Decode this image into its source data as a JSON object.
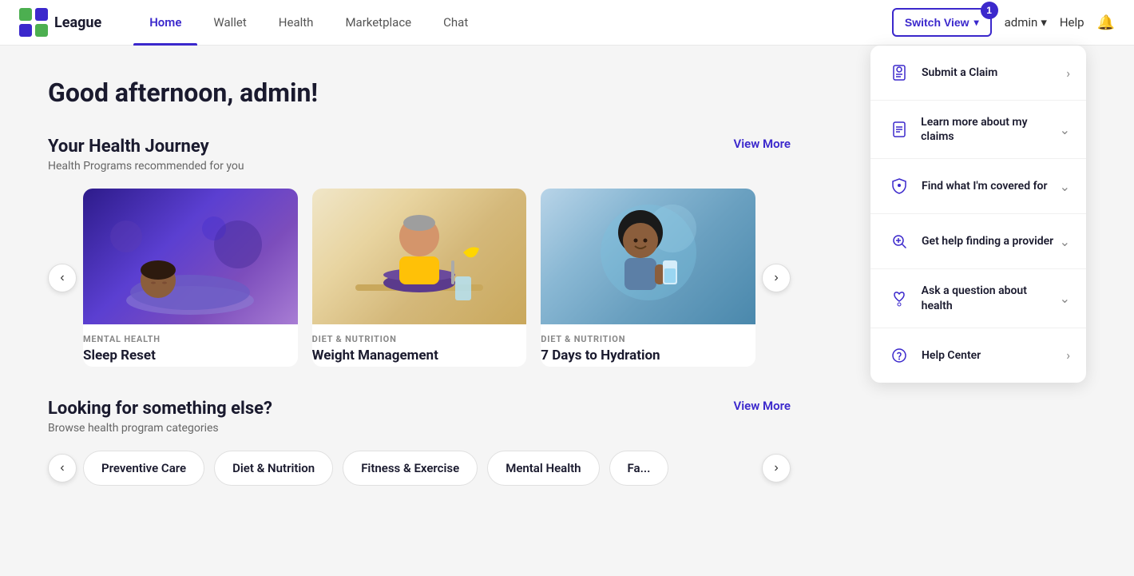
{
  "logo": {
    "text": "League",
    "alt": "League logo"
  },
  "nav": {
    "links": [
      {
        "label": "Home",
        "active": true
      },
      {
        "label": "Wallet",
        "active": false
      },
      {
        "label": "Health",
        "active": false
      },
      {
        "label": "Marketplace",
        "active": false
      },
      {
        "label": "Chat",
        "active": false
      }
    ],
    "switch_view_label": "Switch View",
    "switch_view_badge": "1",
    "admin_label": "admin",
    "help_label": "Help"
  },
  "greeting": "Good afternoon, admin!",
  "health_journey": {
    "title": "Your Health Journey",
    "subtitle": "Health Programs recommended for you",
    "view_more": "View More",
    "cards": [
      {
        "category": "MENTAL HEALTH",
        "title": "Sleep Reset",
        "bg": "sleep"
      },
      {
        "category": "DIET & NUTRITION",
        "title": "Weight Management",
        "bg": "weight"
      },
      {
        "category": "DIET & NUTRITION",
        "title": "7 Days to Hydration",
        "bg": "hydration"
      }
    ]
  },
  "looking_for": {
    "title": "Looking for something else?",
    "subtitle": "Browse health program categories",
    "view_more": "View More",
    "categories": [
      {
        "label": "Preventive Care"
      },
      {
        "label": "Diet & Nutrition"
      },
      {
        "label": "Fitness & Exercise"
      },
      {
        "label": "Mental Health"
      },
      {
        "label": "Fa..."
      }
    ]
  },
  "right_panel": {
    "items": [
      {
        "label": "Submit a Claim",
        "icon": "receipt",
        "action": "arrow"
      },
      {
        "label": "Learn more about my claims",
        "icon": "document",
        "action": "expand"
      },
      {
        "label": "Find what I'm covered for",
        "icon": "shield",
        "action": "expand"
      },
      {
        "label": "Get help finding a provider",
        "icon": "search-plus",
        "action": "expand"
      },
      {
        "label": "Ask a question about health",
        "icon": "heart-chat",
        "action": "expand"
      },
      {
        "label": "Help Center",
        "icon": "question",
        "action": "arrow"
      }
    ]
  }
}
